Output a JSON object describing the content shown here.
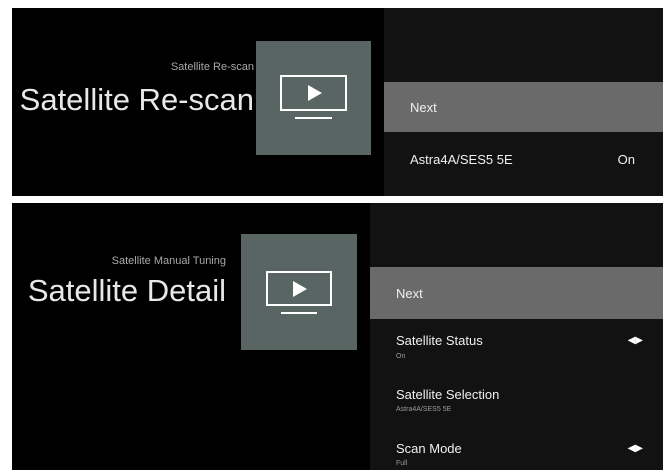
{
  "screen1": {
    "subtitle": "Satellite Re-scan",
    "title": "Satellite Re-scan",
    "menu": {
      "next_label": "Next",
      "satellite_label": "Astra4A/SES5 5E",
      "satellite_value": "On"
    }
  },
  "screen2": {
    "subtitle": "Satellite Manual Tuning",
    "title": "Satellite Detail",
    "menu": {
      "next_label": "Next",
      "status_label": "Satellite Status",
      "status_value": "On",
      "selection_label": "Satellite Selection",
      "selection_value": "Astra4A/SES5 5E",
      "scan_mode_label": "Scan Mode",
      "scan_mode_value": "Full"
    }
  },
  "icons": {
    "tile_icon": "tv-play-icon",
    "arrow_icon": "left-right-arrows-icon"
  },
  "colors": {
    "background": "#000000",
    "menu_panel": "#121212",
    "selected_item": "#6a6a6a",
    "tile": "#596562"
  }
}
